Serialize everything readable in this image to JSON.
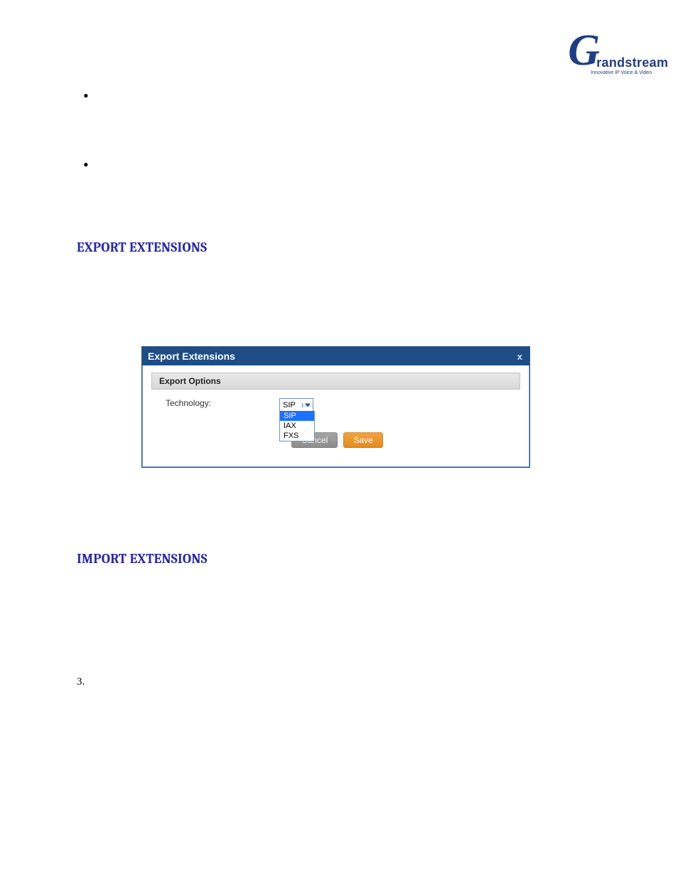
{
  "logo": {
    "brand_g": "G",
    "brand_rest": "randstream",
    "tagline": "Innovative IP Voice & Video"
  },
  "headings": {
    "export": "EXPORT EXTENSIONS",
    "import": "IMPORT EXTENSIONS"
  },
  "list": {
    "step3": "3."
  },
  "dialog": {
    "title": "Export Extensions",
    "close": "x",
    "section": "Export Options",
    "tech_label": "Technology:",
    "tech_value": "SIP",
    "options": [
      "SIP",
      "IAX",
      "FXS"
    ],
    "cancel": "Cancel",
    "save": "Save"
  }
}
